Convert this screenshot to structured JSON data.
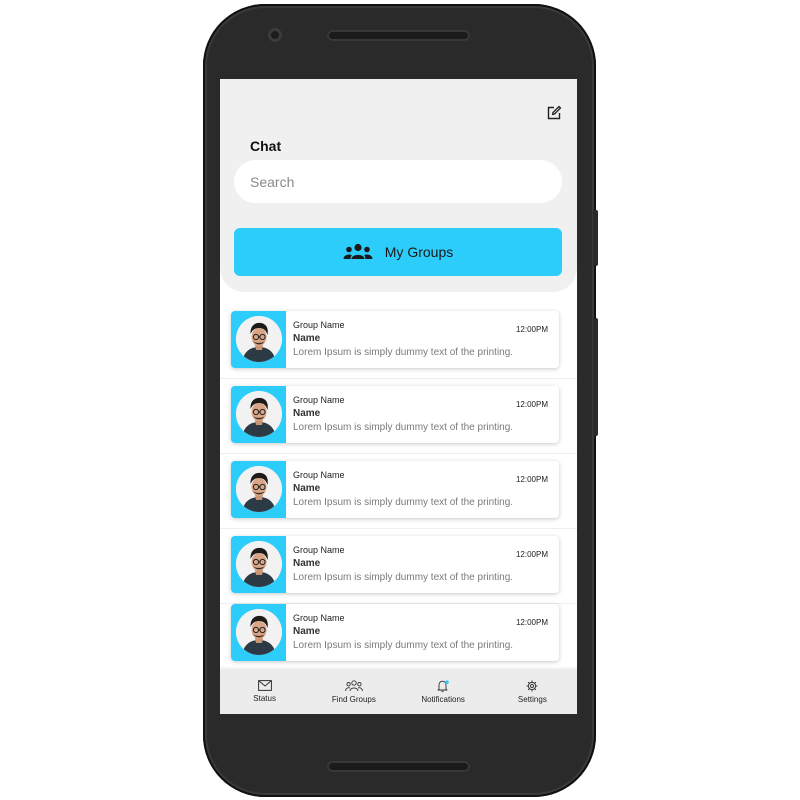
{
  "header": {
    "title": "Chat",
    "compose_icon": "edit-icon"
  },
  "search": {
    "placeholder": "Search",
    "value": ""
  },
  "groups_button": {
    "label": "My Groups",
    "icon": "users-icon"
  },
  "chats": [
    {
      "group": "Group Name",
      "name": "Name",
      "message": "Lorem Ipsum is simply dummy text of the printing.",
      "time": "12:00PM"
    },
    {
      "group": "Group Name",
      "name": "Name",
      "message": "Lorem Ipsum is simply dummy text of the printing.",
      "time": "12:00PM"
    },
    {
      "group": "Group Name",
      "name": "Name",
      "message": "Lorem Ipsum is simply dummy text of the printing.",
      "time": "12:00PM"
    },
    {
      "group": "Group Name",
      "name": "Name",
      "message": "Lorem Ipsum is simply dummy text of the printing.",
      "time": "12:00PM"
    },
    {
      "group": "Group Name",
      "name": "Name",
      "message": "Lorem Ipsum is simply dummy text of the printing.",
      "time": "12:00PM"
    }
  ],
  "nav": [
    {
      "label": "Status",
      "icon": "envelope-icon"
    },
    {
      "label": "Find Groups",
      "icon": "group-icon"
    },
    {
      "label": "Notifications",
      "icon": "bell-icon"
    },
    {
      "label": "Settings",
      "icon": "gear-icon"
    }
  ],
  "colors": {
    "accent": "#2ccdfa",
    "panel": "#f0f0f0",
    "frame": "#2a2a2a",
    "notification_dot": "#2ccdfa"
  }
}
